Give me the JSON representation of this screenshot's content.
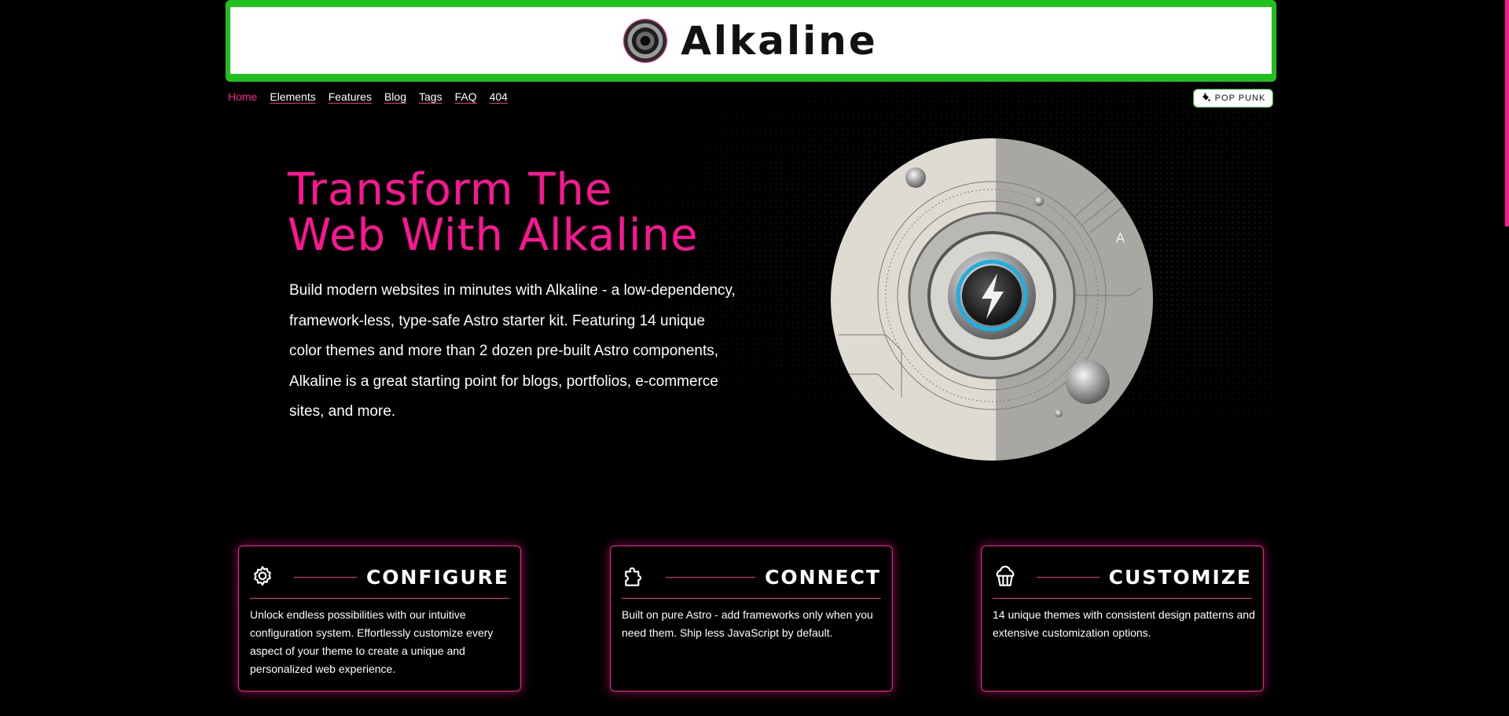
{
  "site": {
    "title": "Alkaline"
  },
  "nav": {
    "items": [
      "Home",
      "Elements",
      "Features",
      "Blog",
      "Tags",
      "FAQ",
      "404"
    ],
    "active": "Home"
  },
  "theme_switcher": {
    "label": "POP PUNK",
    "icon": "paint-bucket-icon"
  },
  "hero": {
    "title_lines": [
      "Transform The",
      "Web With Alkaline"
    ],
    "description": "Build modern websites in minutes with Alkaline - a low-dependency, framework-less, type-safe Astro starter kit. Featuring 14 unique color themes and more than 2 dozen pre-built Astro components, Alkaline is a great starting point for blogs, portfolios, e-commerce sites, and more.",
    "image_text": "A"
  },
  "features": [
    {
      "icon": "gear-icon",
      "title": "CONFIGURE",
      "text": "Unlock endless possibilities with our intuitive configuration system. Effortlessly customize every aspect of your theme to create a unique and personalized web experience."
    },
    {
      "icon": "puzzle-icon",
      "title": "CONNECT",
      "text": "Built on pure Astro - add frameworks only when you need them. Ship less JavaScript by default."
    },
    {
      "icon": "cupcake-icon",
      "title": "CUSTOMIZE",
      "text": "14 unique themes with consistent design patterns and extensive customization options."
    }
  ],
  "colors": {
    "accent": "#ff1493",
    "header_green": "#22c01f",
    "background": "#000000",
    "text": "#ffffff"
  }
}
